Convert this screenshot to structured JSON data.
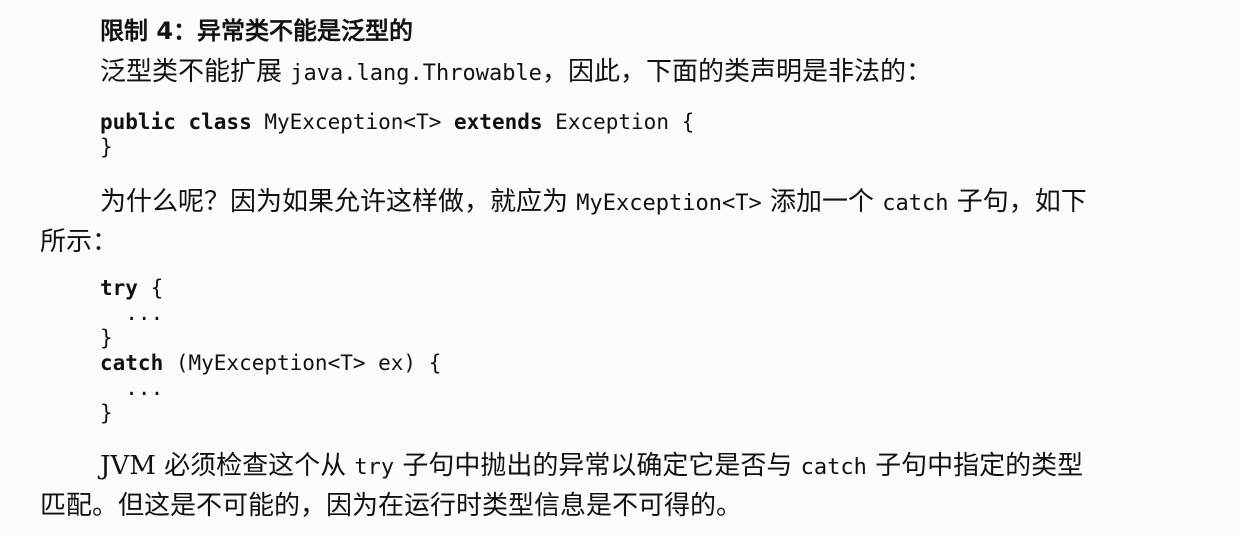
{
  "heading": "限制 4：异常类不能是泛型的",
  "para1": {
    "text_before": "泛型类不能扩展 ",
    "code": "java.lang.Throwable",
    "text_after": "，因此，下面的类声明是非法的："
  },
  "code_block1": {
    "line1_kw1": "public class",
    "line1_mid": " MyException<T> ",
    "line1_kw2": "extends",
    "line1_end": " Exception {",
    "line2": "}"
  },
  "para2": {
    "line1_before": "为什么呢？因为如果允许这样做，就应为 ",
    "line1_code1": "MyException<T>",
    "line1_middle": " 添加一个 ",
    "line1_code2": "catch",
    "line1_after": " 子句，如下",
    "line2": "所示："
  },
  "code_block2": {
    "line1_kw": "try",
    "line1_end": " {",
    "line2": "  ...",
    "line3": "}",
    "line4_kw": "catch",
    "line4_end": " (MyException<T> ex) {",
    "line5": "  ...",
    "line6": "}"
  },
  "para3": {
    "line1_before": "JVM 必须检查这个从 ",
    "line1_code1": "try",
    "line1_middle": " 子句中抛出的异常以确定它是否与 ",
    "line1_code2": "catch",
    "line1_after": " 子句中指定的类型",
    "line2": "匹配。但这是不可能的，因为在运行时类型信息是不可得的。"
  }
}
